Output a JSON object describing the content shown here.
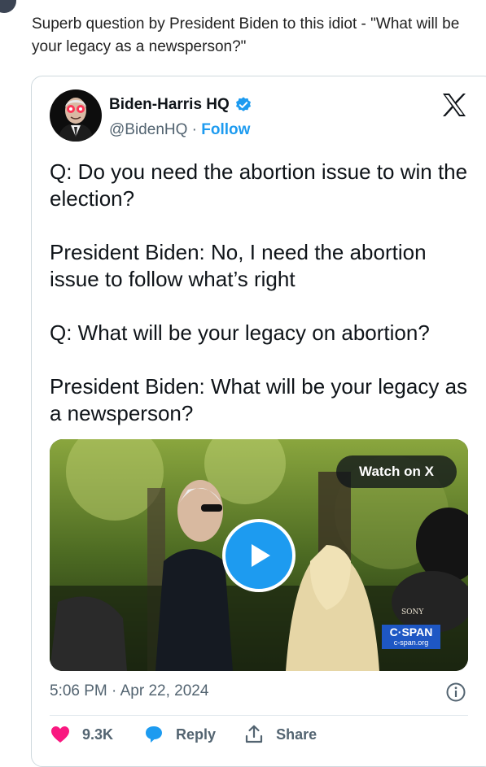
{
  "post": {
    "text": "Superb question by President Biden to this idiot - \"What will be your legacy as a newsperson?\""
  },
  "tweet": {
    "author": {
      "display_name": "Biden-Harris HQ",
      "handle": "@BidenHQ",
      "separator": " · ",
      "follow_label": "Follow",
      "verified": true,
      "avatar_icon": "laser-eyes-avatar-icon"
    },
    "platform_icon": "x-logo-icon",
    "body": [
      "Q: Do you need the abortion issue to win the election?",
      "President Biden: No, I need the abortion issue to follow what’s right",
      "Q: What will be your legacy on abortion?",
      "President Biden: What will be your legacy as a newsperson?"
    ],
    "video": {
      "watch_label": "Watch on X",
      "watermark_main": "C·SPAN",
      "watermark_sub": "c-span.org",
      "camera_brand": "SONY"
    },
    "timestamp": "5:06 PM · Apr 22, 2024",
    "actions": {
      "likes_count": "9.3K",
      "reply_label": "Reply",
      "share_label": "Share"
    }
  },
  "colors": {
    "accent": "#1d9bf0",
    "like": "#f91880",
    "muted": "#536471",
    "border": "#cfd9de",
    "cspan": "#1e57c4"
  }
}
